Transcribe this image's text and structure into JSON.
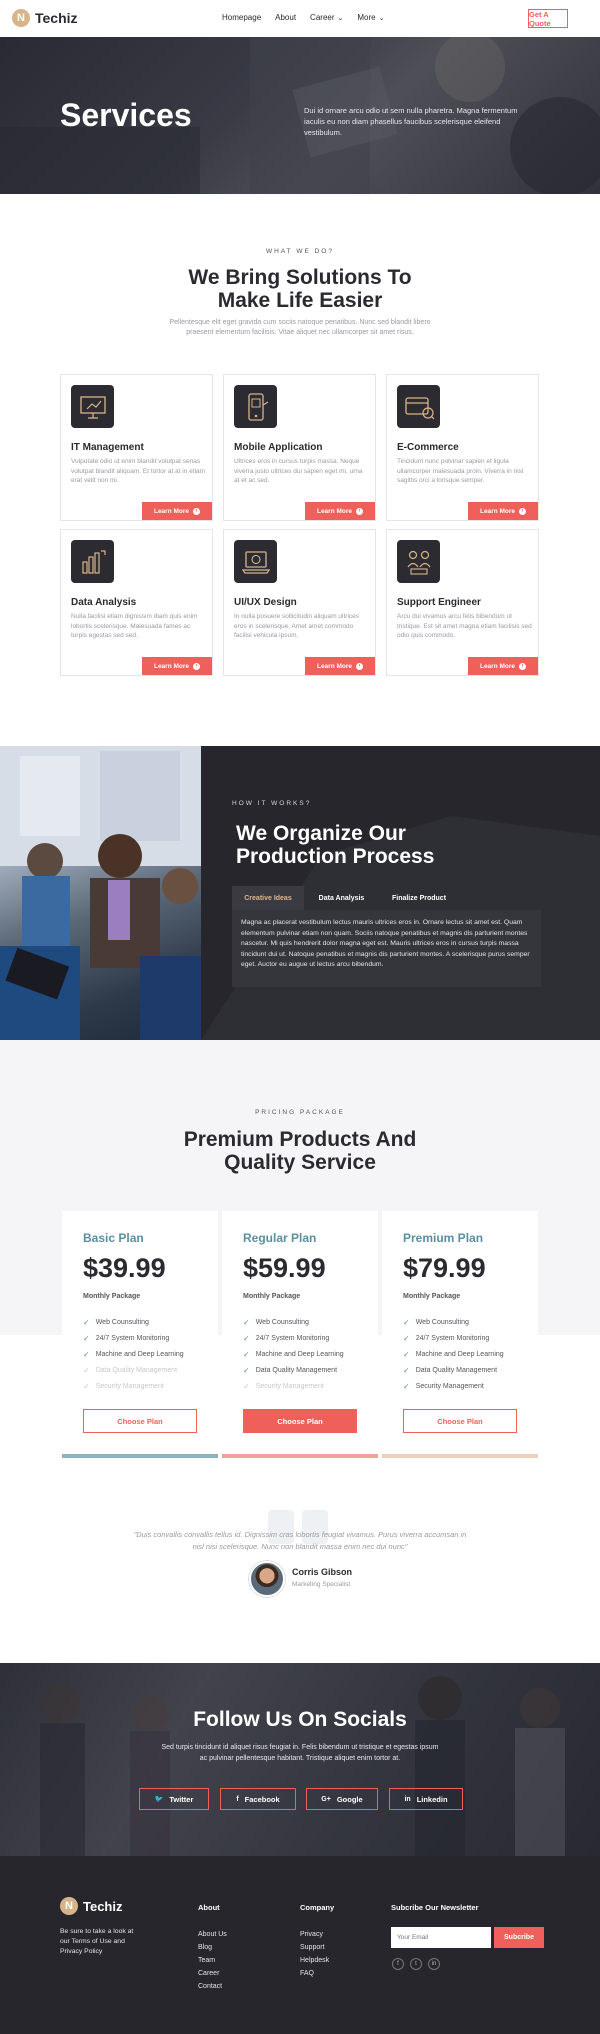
{
  "header": {
    "brand": "Techiz",
    "logo_letter": "N",
    "nav": [
      {
        "label": "Homepage"
      },
      {
        "label": "About"
      },
      {
        "label": "Career",
        "dropdown": "⌄"
      },
      {
        "label": "More",
        "dropdown": "⌄"
      }
    ],
    "cta_label": "Get A Quote"
  },
  "hero": {
    "title": "Services",
    "text": "Dui id ornare arcu odio ut sem nulla pharetra. Magna fermentum iaculis eu non diam phasellus faucibus scelerisque eleifend vestibulum."
  },
  "services": {
    "eyebrow": "WHAT WE DO?",
    "title_line1": "We Bring Solutions To",
    "title_line2": "Make Life Easier",
    "subtitle": "Pellentesque elit eget gravida cum sociis natoque penatibus. Nunc sed blandit libero praesent elementum facilisis. Vitae aliquet nec ullamcorper sit amet risus.",
    "button_label": "Learn More",
    "items": [
      {
        "title": "IT Management",
        "text": "Vulputate odio ut enim blandit volutpat senas volutpat blandit aliquam. Et tortor at at in etiam erat velit non mi.",
        "icon": "monitor-chart-icon"
      },
      {
        "title": "Mobile Application",
        "text": "Ultrices eros in cursus turpis massa. Neque viverra justo ultrices dui sapien eget mi. urna at et ac sed.",
        "icon": "mobile-app-icon"
      },
      {
        "title": "E-Commerce",
        "text": "Tincidunt nunc pulvinar sapien et ligula ullamcorper malesuada proin. Viverra in nisl sagittis orci a lorisque semper.",
        "icon": "credit-card-icon"
      },
      {
        "title": "Data Analysis",
        "text": "Nulla facilisi etiam dignissim diam quis enim lobortis scelerisque. Malesuada fames ac turpis egestas sed sed.",
        "icon": "bar-chart-icon"
      },
      {
        "title": "UI/UX Design",
        "text": "In nulla posuere sollicitudin aliquam ultrices eros in scelerisque. Amet amet commodo facilisi vehicula ipsum.",
        "icon": "laptop-design-icon"
      },
      {
        "title": "Support Engineer",
        "text": "Arcu dui vivamus arcu felis bibendum ut tristique. Est sit amet magna etiam facilisis sed odio quis commodo.",
        "icon": "support-team-icon"
      }
    ]
  },
  "process": {
    "eyebrow": "HOW IT WORKS?",
    "title_line1": "We Organize Our",
    "title_line2": "Production Process",
    "tabs": [
      {
        "label": "Creative Ideas",
        "active": true
      },
      {
        "label": "Data Analysis",
        "active": false
      },
      {
        "label": "Finalize Product",
        "active": false
      }
    ],
    "body": "Magna ac placerat vestibulum lectus mauris ultrices eros in. Ornare lectus sit amet est. Quam elementum pulvinar etiam non quam. Sociis natoque penatibus et magnis dis parturient montes nascetur. Mi quis hendrerit dolor magna eget est. Mauris ultrices eros in cursus turpis massa tincidunt dui ut. Natoque penatibus et magnis dis parturient montes. A scelerisque purus semper eget. Auctor eu augue ut lectus arcu bibendum."
  },
  "pricing": {
    "eyebrow": "PRICING PACKAGE",
    "title_line1": "Premium Products And",
    "title_line2": "Quality Service",
    "button_label": "Choose Plan",
    "plans": [
      {
        "name": "Basic Plan",
        "price": "$39.99",
        "period": "Monthly Package",
        "bar_color": "#8fb3bd",
        "filled": false,
        "features": [
          {
            "t": "Web Counsulting",
            "on": true
          },
          {
            "t": "24/7 System Monitoring",
            "on": true
          },
          {
            "t": "Machine and Deep Learning",
            "on": true
          },
          {
            "t": "Data Quality Management",
            "on": false
          },
          {
            "t": "Security Management",
            "on": false
          }
        ]
      },
      {
        "name": "Regular Plan",
        "price": "$59.99",
        "period": "Monthly Package",
        "bar_color": "#f3a29c",
        "filled": true,
        "features": [
          {
            "t": "Web Counsulting",
            "on": true
          },
          {
            "t": "24/7 System Monitoring",
            "on": true
          },
          {
            "t": "Machine and Deep Learning",
            "on": true
          },
          {
            "t": "Data Quality Management",
            "on": true
          },
          {
            "t": "Security Management",
            "on": false
          }
        ]
      },
      {
        "name": "Premium Plan",
        "price": "$79.99",
        "period": "Monthly Package",
        "bar_color": "#efcfbd",
        "filled": false,
        "features": [
          {
            "t": "Web Counsulting",
            "on": true
          },
          {
            "t": "24/7 System Monitoring",
            "on": true
          },
          {
            "t": "Machine and Deep Learning",
            "on": true
          },
          {
            "t": "Data Quality Management",
            "on": true
          },
          {
            "t": "Security Management",
            "on": true
          }
        ]
      }
    ]
  },
  "testimonial": {
    "quote": "\"Duis convallis convallis tellus id. Dignissim cras lobortis feugiat vivamus. Purus viverra accumsan in nisl nisi scelerisque. Nunc non blandit massa enim nec dui nunc\"",
    "name": "Corris Gibson",
    "role": "Marketing Specialist"
  },
  "socials": {
    "title": "Follow Us On Socials",
    "text": "Sed turpis tincidunt id aliquet risus feugiat in. Felis bibendum ut tristique et egestas ipsum ac pulvinar pellentesque habitant. Tristique aliquet enim tortor at.",
    "buttons": [
      {
        "label": "Twitter",
        "glyph": "🐦"
      },
      {
        "label": "Facebook",
        "glyph": "f"
      },
      {
        "label": "Google",
        "glyph": "G+"
      },
      {
        "label": "Linkedin",
        "glyph": "in"
      }
    ]
  },
  "footer": {
    "brand": "Techiz",
    "terms_text": "Be sure to take a look at our Terms of Use and Privacy Policy",
    "about_heading": "About",
    "about_links": [
      "About Us",
      "Blog",
      "Team",
      "Career",
      "Contact"
    ],
    "company_heading": "Company",
    "company_links": [
      "Privacy",
      "Support",
      "Helpdesk",
      "FAQ"
    ],
    "newsletter_heading": "Subcribe Our Newsletter",
    "email_placeholder": "Your Email",
    "subscribe_label": "Subcribe"
  },
  "colors": {
    "accent": "#f0605a",
    "dark": "#26262c",
    "teal": "#5b8fa0",
    "gold": "#d8b48a"
  }
}
